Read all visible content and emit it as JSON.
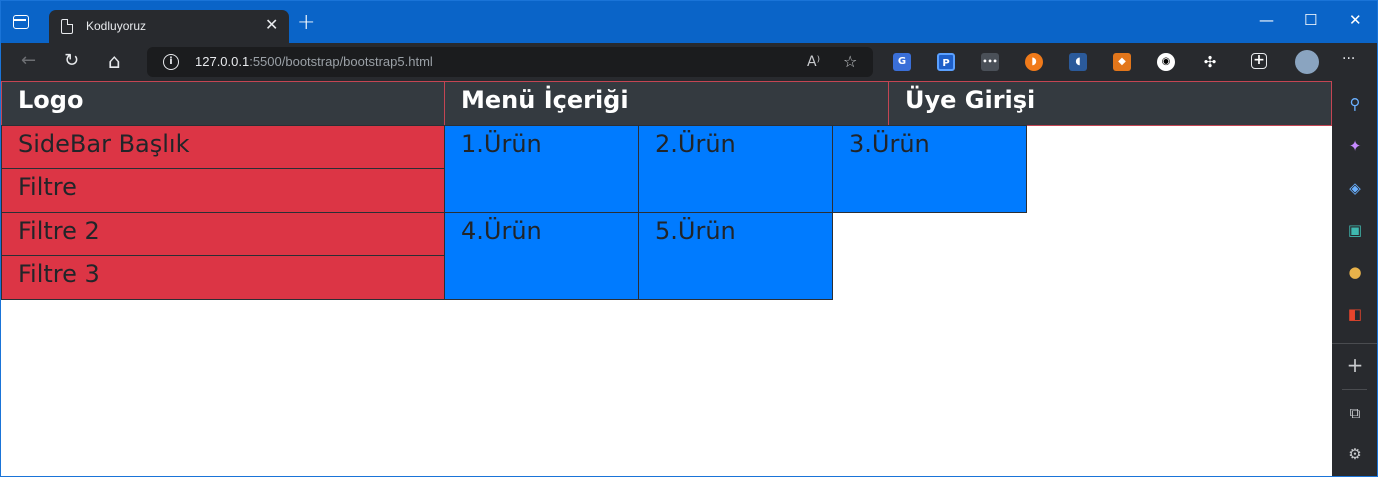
{
  "browser": {
    "tab_title": "Kodluyoruz",
    "tab_close": "✕",
    "new_tab": "+",
    "minimize": "—",
    "maximize": "☐",
    "close": "✕",
    "url_host": "127.0.0.1",
    "url_path": ":5500/bootstrap/bootstrap5.html",
    "back": "←",
    "refresh": "↻",
    "home": "⌂",
    "read_aloud": "A⁾",
    "favorite": "☆",
    "more": "···"
  },
  "page": {
    "header": {
      "logo": "Logo",
      "menu": "Menü İçeriği",
      "login": "Üye Girişi"
    },
    "sidebar": {
      "items": [
        "SideBar Başlık",
        "Filtre",
        "Filtre 2",
        "Filtre 3"
      ]
    },
    "products": [
      "1.Ürün",
      "2.Ürün",
      "3.Ürün",
      "4.Ürün",
      "5.Ürün"
    ]
  },
  "colors": {
    "header_bg": "#343a40",
    "sidebar_bg": "#dc3545",
    "product_bg": "#007bff"
  }
}
